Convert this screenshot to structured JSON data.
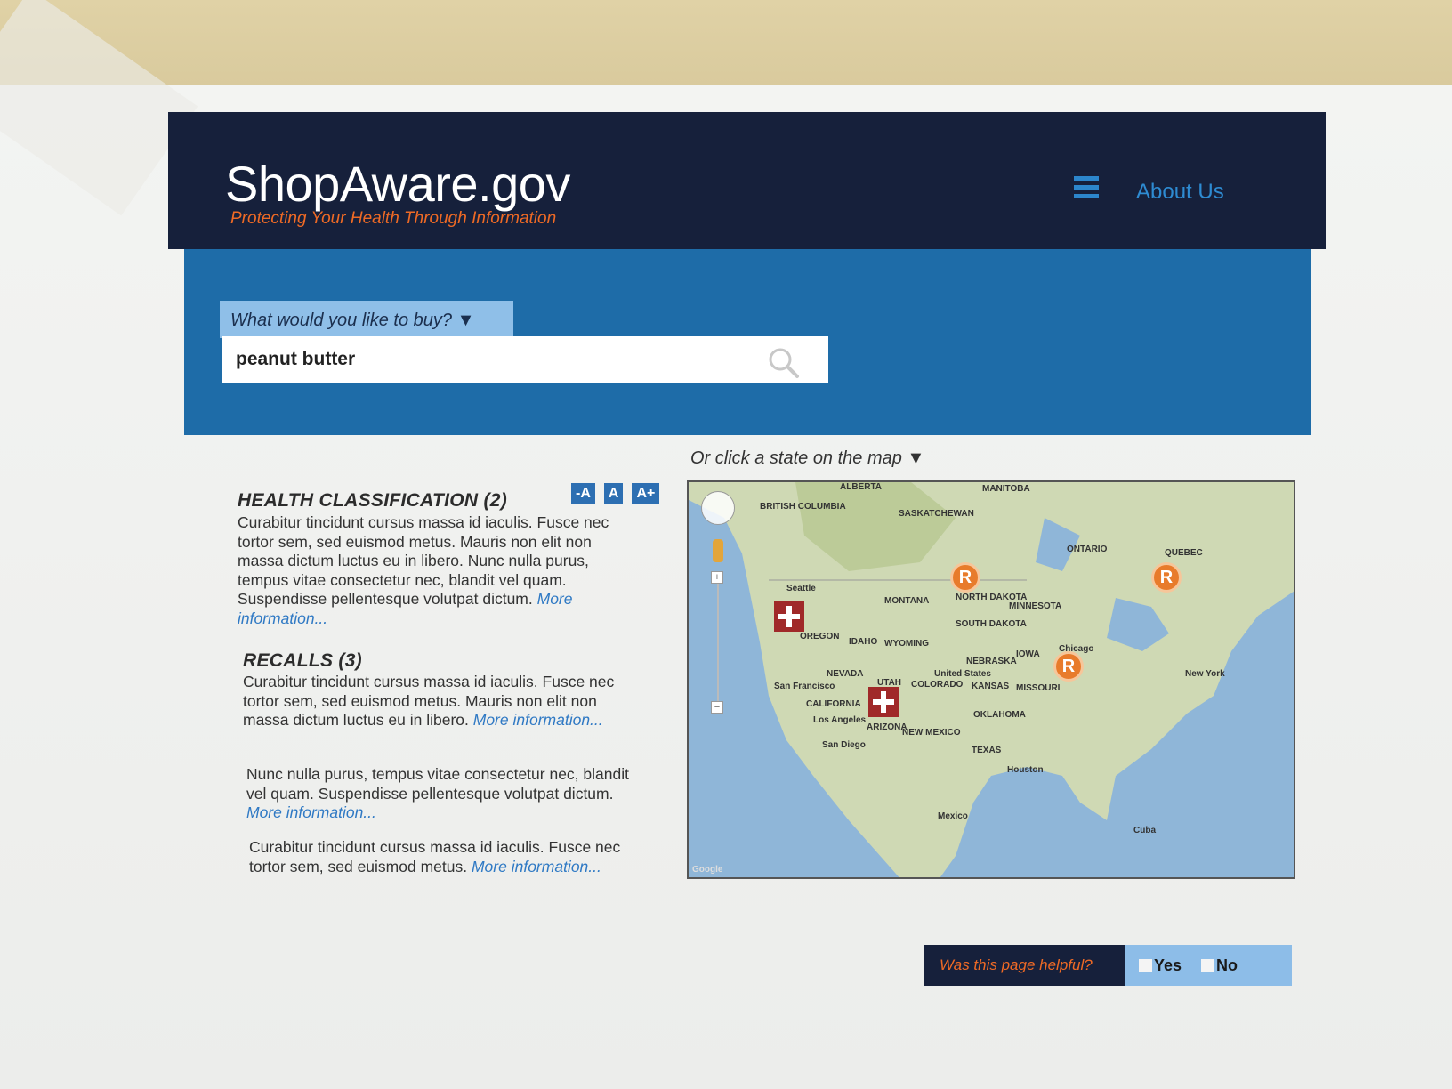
{
  "header": {
    "logo": "ShopAware.gov",
    "tagline": "Protecting Your Health Through Information",
    "menu_icon": "hamburger-menu-icon",
    "about_label": "About Us"
  },
  "search": {
    "dropdown_label": "What would you like to buy? ▼",
    "value": "peanut butter",
    "icon": "search-icon"
  },
  "text_size": {
    "decrease": "-A",
    "normal": "A",
    "increase": "A+"
  },
  "health": {
    "title": "HEALTH CLASSIFICATION (2)",
    "body": "Curabitur tincidunt cursus massa id iaculis. Fusce nec tortor sem, sed euismod metus. Mauris non elit non massa dictum luctus eu in libero. Nunc nulla purus, tempus vitae consectetur nec, blandit vel quam. Suspendisse pellentesque volutpat dictum.",
    "link": "More information..."
  },
  "recalls": {
    "title": "RECALLS (3)",
    "items": [
      {
        "body": "Curabitur tincidunt cursus massa id iaculis. Fusce nec tortor sem, sed euismod metus. Mauris non elit non massa dictum luctus eu in libero.",
        "link": "More information..."
      },
      {
        "body": "Nunc nulla purus, tempus vitae consectetur nec, blandit vel quam. Suspendisse pellentesque volutpat dictum.",
        "link": "More information..."
      },
      {
        "body": "Curabitur tincidunt cursus massa id iaculis. Fusce nec tortor sem, sed euismod metus.",
        "link": "More information..."
      }
    ]
  },
  "map": {
    "label": "Or click a state on the map ▼",
    "marker_letter": "R",
    "places": {
      "alberta": "ALBERTA",
      "manitoba": "MANITOBA",
      "bc": "BRITISH COLUMBIA",
      "saskatchewan": "SASKATCHEWAN",
      "ontario": "ONTARIO",
      "quebec": "QUEBEC",
      "montana": "MONTANA",
      "north_dakota": "NORTH DAKOTA",
      "minnesota": "MINNESOTA",
      "south_dakota": "SOUTH DAKOTA",
      "wyoming": "WYOMING",
      "idaho": "IDAHO",
      "oregon": "OREGON",
      "nevada": "NEVADA",
      "utah": "UTAH",
      "colorado": "COLORADO",
      "kansas": "KANSAS",
      "nebraska": "NEBRASKA",
      "iowa": "IOWA",
      "missouri": "MISSOURI",
      "oklahoma": "OKLAHOMA",
      "texas": "TEXAS",
      "arizona": "ARIZONA",
      "new_mexico": "NEW MEXICO",
      "california": "CALIFORNIA",
      "united_states": "United States",
      "chicago": "Chicago",
      "seattle": "Seattle",
      "san_francisco": "San Francisco",
      "los_angeles": "Los Angeles",
      "san_diego": "San Diego",
      "houston": "Houston",
      "mexico": "Mexico",
      "new_york": "New York",
      "cuba": "Cuba",
      "google": "Google"
    }
  },
  "feedback": {
    "question": "Was this page helpful?",
    "yes": "Yes",
    "no": "No"
  },
  "colors": {
    "header_dark": "#16203b",
    "header_blue": "#1e6ca8",
    "accent_orange": "#ef6a25",
    "link_blue": "#2f79c4"
  }
}
